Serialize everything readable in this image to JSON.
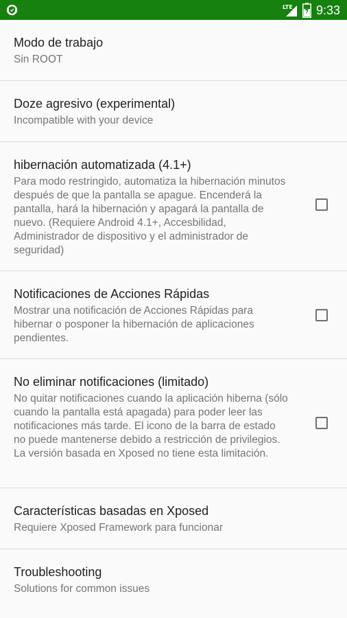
{
  "status_bar": {
    "network": "LTE",
    "time": "9:33"
  },
  "settings": [
    {
      "title": "Modo de trabajo",
      "summary": "Sin ROOT"
    },
    {
      "title": "Doze agresivo (experimental)",
      "summary": "Incompatible with your device"
    },
    {
      "title": "hibernación automatizada (4.1+)",
      "summary": "Para modo restringido, automatiza la hibernación minutos después de que la pantalla se apague. Encenderá la pantalla, hará la hibernación y apagará la pantalla de nuevo. (Requiere Android 4.1+, Accesbilidad, Administrador de dispositivo y el administrador de seguridad)",
      "checked": false
    },
    {
      "title": "Notificaciones de Acciones Rápidas",
      "summary": "Mostrar una notificación de Acciones Rápidas para hibernar o posponer la hibernación de aplicaciones pendientes.",
      "checked": false
    },
    {
      "title": "No eliminar notificaciones (limitado)",
      "summary": "No quitar notificaciones cuando la aplicación hiberna (sólo cuando la pantalla está apagada) para poder leer las notificaciones más tarde. El icono de la barra de estado no puede mantenerse debido a restricción de privilegios. La versión basada en Xposed no tiene esta limitación.",
      "checked": false
    },
    {
      "title": "Características basadas en Xposed",
      "summary": "Requiere Xposed Framework para funcionar"
    },
    {
      "title": "Troubleshooting",
      "summary": "Solutions for common issues"
    }
  ],
  "colors": {
    "status_bar": "#16810f",
    "title_text": "#212121",
    "summary_text": "#757575",
    "divider": "#dcdcdc",
    "background": "#fafafa"
  }
}
